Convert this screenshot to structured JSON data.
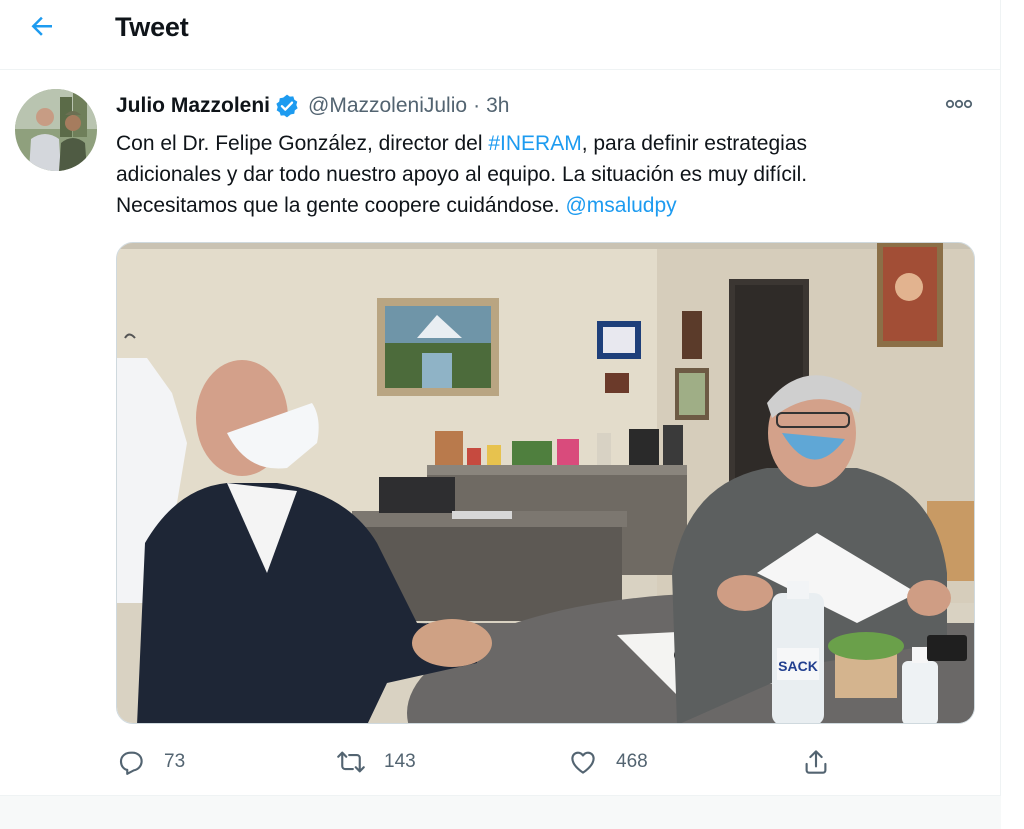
{
  "header": {
    "title": "Tweet"
  },
  "tweet": {
    "author_name": "Julio Mazzoleni",
    "handle": "@MazzoleniJulio",
    "separator": "·",
    "time": "3h",
    "text_line1_a": "Con el Dr. Felipe González, director del ",
    "text_line1_hashtag": "#INERAM",
    "text_line1_b": ", para definir estrategias",
    "text_line2": "adicionales y dar todo nuestro apoyo al equipo. La situación es muy difícil.",
    "text_line3_a": "Necesitamos que la gente coopere cuidándose. ",
    "text_line3_mention": "@msaludpy",
    "bottle_label": "SACK"
  },
  "actions": {
    "replies": "73",
    "retweets": "143",
    "likes": "468"
  },
  "colors": {
    "accent": "#1d9bf0",
    "text_primary": "#0f1419",
    "text_secondary": "#536471",
    "border": "#eff3f4"
  },
  "icons": {
    "back": "arrow-left-icon",
    "verified": "verified-badge-icon",
    "more": "more-dots-icon",
    "reply": "reply-icon",
    "retweet": "retweet-icon",
    "like": "heart-icon",
    "share": "share-icon"
  }
}
